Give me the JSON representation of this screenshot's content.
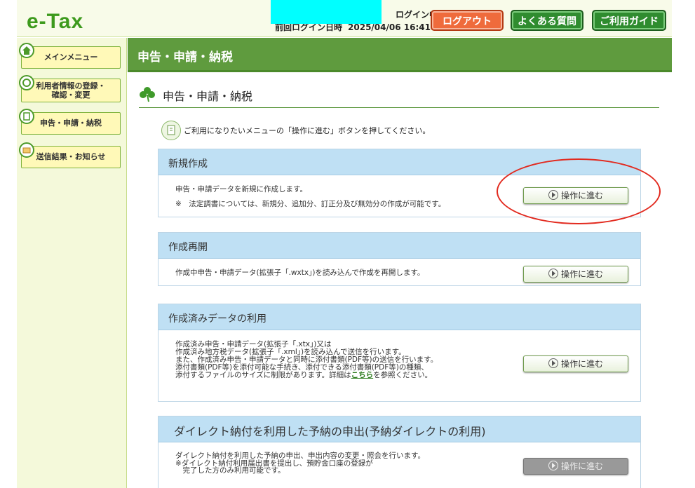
{
  "header": {
    "logo": "e-Tax",
    "login_status": "ログイン中",
    "last_login_label": "前回ログイン日時",
    "last_login_value": "2025/04/06 16:41",
    "logout_label": "ログアウト",
    "faq_label": "よくある質問",
    "guide_label": "ご利用ガイド"
  },
  "sidebar": {
    "items": [
      {
        "label": "メインメニュー",
        "icon": "home-icon"
      },
      {
        "label": "利用者情報の登録・確認・変更",
        "line1": "利用者情報の登録・",
        "line2": "確認・変更",
        "icon": "user-icon"
      },
      {
        "label": "申告・申請・納税",
        "icon": "document-icon"
      },
      {
        "label": "送信結果・お知らせ",
        "icon": "mail-icon"
      }
    ]
  },
  "main": {
    "header_title": "申告・申請・納税",
    "page_title": "申告・申請・納税",
    "instruction": "ご利用になりたいメニューの「操作に進む」ボタンを押してください。",
    "sections": [
      {
        "title": "新規作成",
        "lines": [
          "申告・申請データを新規に作成します。",
          "※　法定調書については、新規分、追加分、訂正分及び無効分の作成が可能です。"
        ],
        "button": "操作に進む"
      },
      {
        "title": "作成再開",
        "lines": [
          "作成中申告・申請データ(拡張子「.wxtx」)を読み込んで作成を再開します。"
        ],
        "button": "操作に進む"
      },
      {
        "title": "作成済みデータの利用",
        "lines": [
          "作成済み申告・申請データ(拡張子「.xtx」)又は",
          "作成済み地方税データ(拡張子「.xml」)を読み込んで送信を行います。",
          "また、作成済み申告・申請データと同時に添付書類(PDF等)の送信を行います。",
          "添付書類(PDF等)を添付可能な手続き、添付できる添付書類(PDF等)の種類、",
          "添付するファイルのサイズに制限があります。詳細は"
        ],
        "link": "こちら",
        "link_after": "を参照ください。",
        "button": "操作に進む"
      },
      {
        "title": "ダイレクト納付を利用した予納の申出(予納ダイレクトの利用)",
        "lines": [
          "ダイレクト納付を利用した予納の申出、申出内容の変更・照会を行います。",
          "※ダイレクト納付利用届出書を提出し、預貯金口座の登録が",
          "　完了した方のみ利用可能です。"
        ],
        "button": "操作に進む"
      }
    ]
  },
  "colors": {
    "brand_green": "#3d9a1d",
    "header_green": "#5f9b3e",
    "section_blue": "#bfe0f4",
    "logout_orange": "#ef6b3c",
    "annotation_red": "#e22a1f"
  }
}
